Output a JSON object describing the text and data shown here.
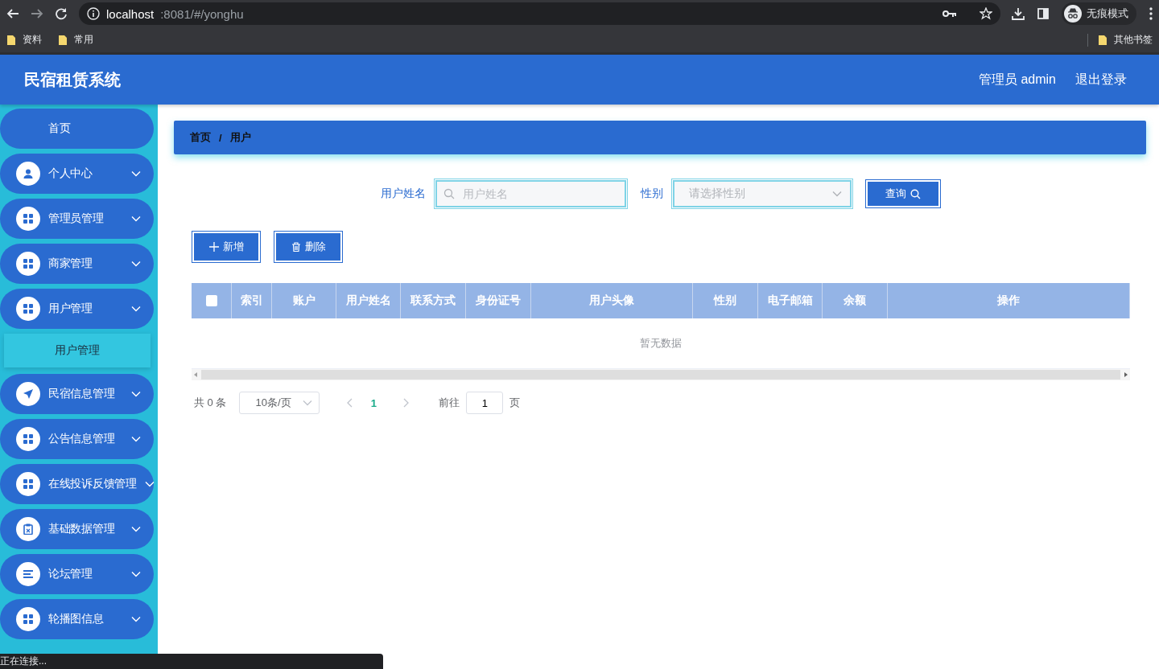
{
  "browser": {
    "url_host": "localhost",
    "url_rest": ":8081/#/yonghu",
    "profile_label": "无痕模式",
    "bookmarks": [
      "资料",
      "常用"
    ],
    "other_bookmarks": "其他书签"
  },
  "header": {
    "title": "民宿租赁系统",
    "user": "管理员 admin",
    "logout": "退出登录"
  },
  "sidebar": {
    "items": [
      {
        "label": "首页",
        "kind": "plain"
      },
      {
        "label": "个人中心",
        "kind": "user"
      },
      {
        "label": "管理员管理",
        "kind": "grid"
      },
      {
        "label": "商家管理",
        "kind": "grid"
      },
      {
        "label": "用户管理",
        "kind": "grid",
        "children": [
          {
            "label": "用户管理",
            "selected": true
          }
        ]
      },
      {
        "label": "民宿信息管理",
        "kind": "plane"
      },
      {
        "label": "公告信息管理",
        "kind": "grid"
      },
      {
        "label": "在线投诉反馈管理",
        "kind": "grid"
      },
      {
        "label": "基础数据管理",
        "kind": "clipboard"
      },
      {
        "label": "论坛管理",
        "kind": "list"
      },
      {
        "label": "轮播图信息",
        "kind": "grid"
      }
    ]
  },
  "breadcrumb": {
    "items": [
      "首页",
      "用户"
    ],
    "separator": "/"
  },
  "search": {
    "fields": [
      {
        "kind": "text",
        "label": "用户姓名",
        "placeholder": "用户姓名"
      },
      {
        "kind": "select",
        "label": "性别",
        "placeholder": "请选择性别"
      }
    ],
    "button": "查询"
  },
  "actions": [
    {
      "label": "新增",
      "kind": "add"
    },
    {
      "label": "删除",
      "kind": "delete"
    }
  ],
  "table": {
    "columns": [
      {
        "kind": "checkbox",
        "checked": false
      },
      {
        "kind": "text",
        "label": "索引"
      },
      {
        "kind": "text",
        "label": "账户"
      },
      {
        "kind": "text",
        "label": "用户姓名"
      },
      {
        "kind": "text",
        "label": "联系方式"
      },
      {
        "kind": "text",
        "label": "身份证号"
      },
      {
        "kind": "text",
        "label": "用户头像"
      },
      {
        "kind": "text",
        "label": "性别"
      },
      {
        "kind": "text",
        "label": "电子邮箱"
      },
      {
        "kind": "text",
        "label": "余额"
      },
      {
        "kind": "text",
        "label": "操作"
      }
    ],
    "empty_text": "暂无数据"
  },
  "pagination": {
    "total": "共 0 条",
    "page_size": "10条/页",
    "pages": [
      {
        "label": "1",
        "selected": true
      }
    ],
    "goto_label": "前往",
    "goto_value": "1",
    "goto_suffix": "页"
  },
  "status_bubble": "正在连接..."
}
